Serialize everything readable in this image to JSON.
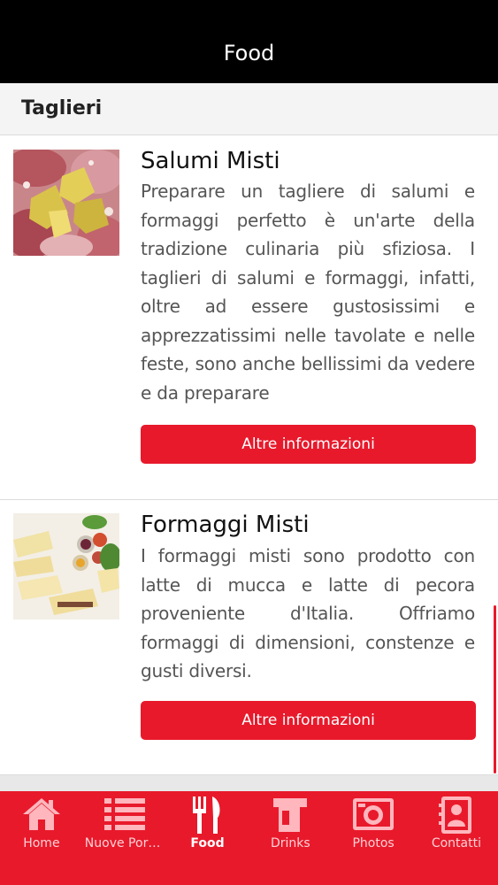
{
  "header": {
    "title": "Food"
  },
  "section": {
    "title": "Taglieri"
  },
  "items": [
    {
      "title": "Salumi Misti",
      "description": "Preparare un tagliere di salumi e formaggi perfetto è un'arte della tradizione culinaria più sfiziosa. I taglieri di salumi e formaggi, infatti, oltre ad essere gustosissimi e apprezzatissimi nelle tavolate e nelle feste, sono anche bellissimi da vedere e da preparare",
      "button_label": "Altre informazioni",
      "image_icon": "cured-meats-photo"
    },
    {
      "title": "Formaggi Misti",
      "description": "I formaggi misti sono prodotto con latte di mucca e latte di pecora proveniente d'Italia. Offriamo formaggi di dimensioni, constenze e gusti diversi.",
      "button_label": "Altre informazioni",
      "image_icon": "cheese-platter-photo"
    }
  ],
  "tabbar": {
    "active_index": 2,
    "tabs": [
      {
        "label": "Home",
        "icon": "home-icon"
      },
      {
        "label": "Nuove Port...",
        "icon": "list-icon"
      },
      {
        "label": "Food",
        "icon": "fork-knife-icon"
      },
      {
        "label": "Drinks",
        "icon": "mug-icon"
      },
      {
        "label": "Photos",
        "icon": "camera-icon"
      },
      {
        "label": "Contatti",
        "icon": "contact-book-icon"
      }
    ]
  },
  "colors": {
    "accent": "#e8192b",
    "header_bg": "#000000",
    "section_bg": "#f4f4f4"
  }
}
